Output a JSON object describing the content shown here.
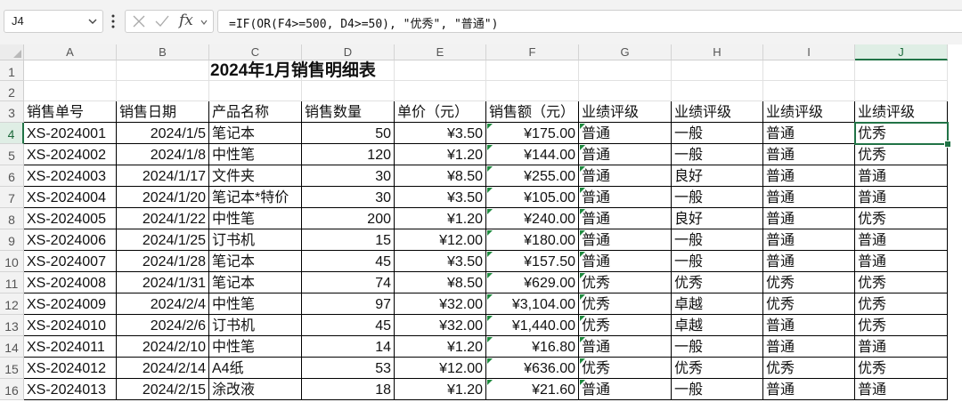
{
  "name_box": {
    "value": "J4"
  },
  "formula_bar": {
    "fx_label": "fx",
    "formula": "=IF(OR(F4>=500, D4>=50), \"优秀\", \"普通\")"
  },
  "sheet": {
    "active_cell": "J4",
    "accent_color": "#217346",
    "columns": [
      "A",
      "B",
      "C",
      "D",
      "E",
      "F",
      "G",
      "H",
      "I",
      "J"
    ],
    "row_numbers": [
      "1",
      "2",
      "3",
      "4",
      "5",
      "6",
      "7",
      "8",
      "9",
      "10",
      "11",
      "12",
      "13",
      "14",
      "15",
      "16"
    ],
    "title": "2024年1月销售明细表",
    "headers": [
      "销售单号",
      "销售日期",
      "产品名称",
      "销售数量",
      "单价（元）",
      "销售额（元）",
      "业绩评级",
      "业绩评级",
      "业绩评级",
      "业绩评级"
    ],
    "rows": [
      [
        "XS-2024001",
        "2024/1/5",
        "笔记本",
        "50",
        "¥3.50",
        "¥175.00",
        "普通",
        "一般",
        "普通",
        "优秀"
      ],
      [
        "XS-2024002",
        "2024/1/8",
        "中性笔",
        "120",
        "¥1.20",
        "¥144.00",
        "普通",
        "一般",
        "普通",
        "优秀"
      ],
      [
        "XS-2024003",
        "2024/1/17",
        "文件夹",
        "30",
        "¥8.50",
        "¥255.00",
        "普通",
        "良好",
        "普通",
        "普通"
      ],
      [
        "XS-2024004",
        "2024/1/20",
        "笔记本*特价",
        "30",
        "¥3.50",
        "¥105.00",
        "普通",
        "一般",
        "普通",
        "普通"
      ],
      [
        "XS-2024005",
        "2024/1/22",
        "中性笔",
        "200",
        "¥1.20",
        "¥240.00",
        "普通",
        "良好",
        "普通",
        "优秀"
      ],
      [
        "XS-2024006",
        "2024/1/25",
        "订书机",
        "15",
        "¥12.00",
        "¥180.00",
        "普通",
        "一般",
        "普通",
        "普通"
      ],
      [
        "XS-2024007",
        "2024/1/28",
        "笔记本",
        "45",
        "¥3.50",
        "¥157.50",
        "普通",
        "一般",
        "普通",
        "普通"
      ],
      [
        "XS-2024008",
        "2024/1/31",
        "笔记本",
        "74",
        "¥8.50",
        "¥629.00",
        "优秀",
        "优秀",
        "优秀",
        "优秀"
      ],
      [
        "XS-2024009",
        "2024/2/4",
        "中性笔",
        "97",
        "¥32.00",
        "¥3,104.00",
        "优秀",
        "卓越",
        "优秀",
        "优秀"
      ],
      [
        "XS-2024010",
        "2024/2/6",
        "订书机",
        "45",
        "¥32.00",
        "¥1,440.00",
        "优秀",
        "卓越",
        "普通",
        "优秀"
      ],
      [
        "XS-2024011",
        "2024/2/10",
        "中性笔",
        "14",
        "¥1.20",
        "¥16.80",
        "普通",
        "一般",
        "普通",
        "普通"
      ],
      [
        "XS-2024012",
        "2024/2/14",
        "A4纸",
        "53",
        "¥12.00",
        "¥636.00",
        "优秀",
        "优秀",
        "优秀",
        "优秀"
      ],
      [
        "XS-2024013",
        "2024/2/15",
        "涂改液",
        "18",
        "¥1.20",
        "¥21.60",
        "普通",
        "一般",
        "普通",
        "普通"
      ]
    ]
  }
}
